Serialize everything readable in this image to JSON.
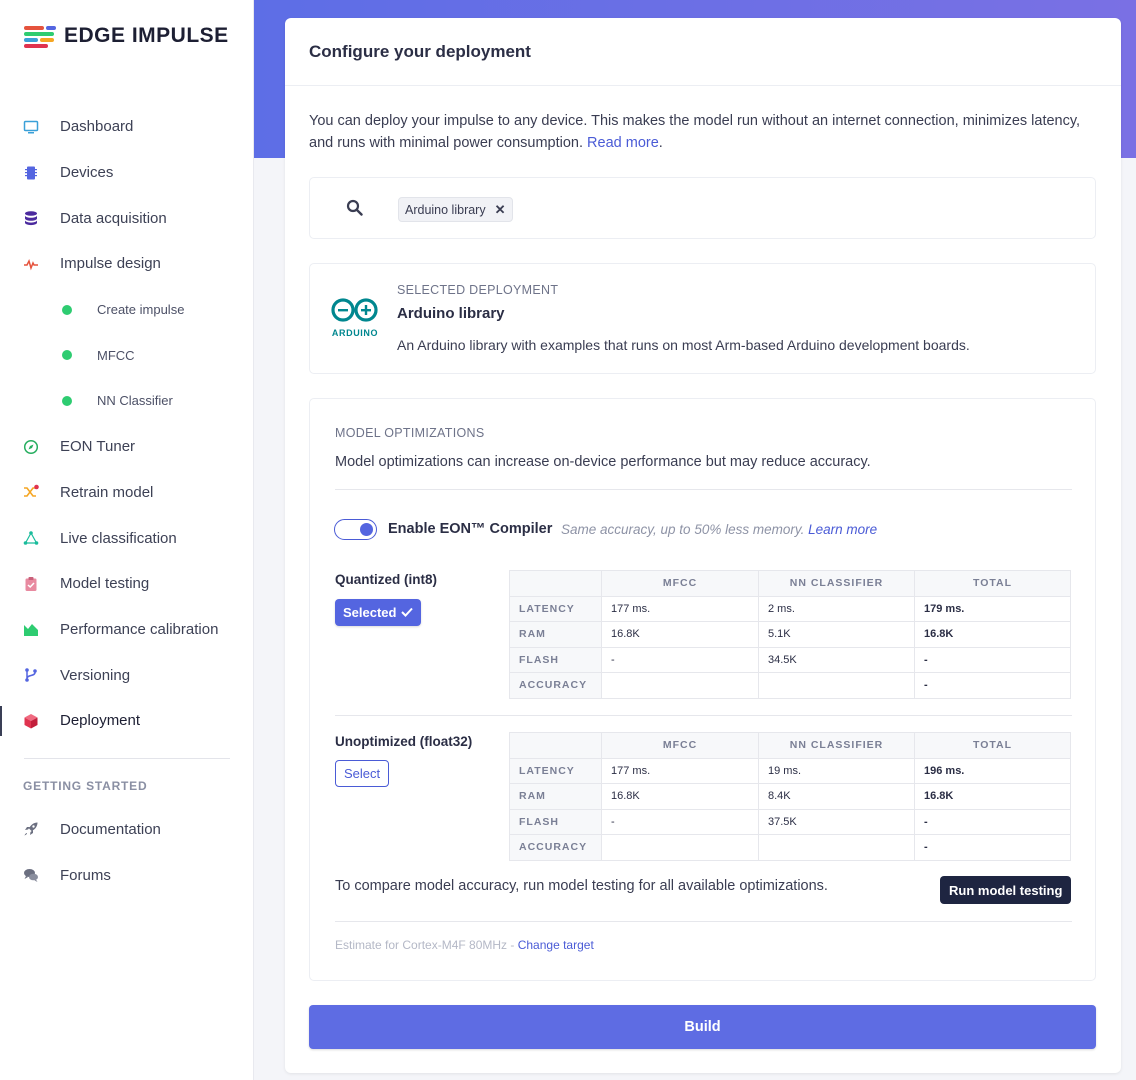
{
  "brand": {
    "name": "EDGE IMPULSE"
  },
  "sidebar": {
    "items": [
      {
        "label": "Dashboard",
        "icon": "monitor-icon",
        "color": "#3aa0d8"
      },
      {
        "label": "Devices",
        "icon": "chip-icon",
        "color": "#5465e0"
      },
      {
        "label": "Data acquisition",
        "icon": "database-icon",
        "color": "#4b2a9e"
      },
      {
        "label": "Impulse design",
        "icon": "pulse-icon",
        "color": "#e5533d"
      },
      {
        "label": "Create impulse",
        "sub": true
      },
      {
        "label": "MFCC",
        "sub": true
      },
      {
        "label": "NN Classifier",
        "sub": true
      },
      {
        "label": "EON Tuner",
        "icon": "compass-icon",
        "color": "#27ae60"
      },
      {
        "label": "Retrain model",
        "icon": "shuffle-icon",
        "color": "#f5a623"
      },
      {
        "label": "Live classification",
        "icon": "network-icon",
        "color": "#1abc9c"
      },
      {
        "label": "Model testing",
        "icon": "clipboard-check-icon",
        "color": "#e88aa0"
      },
      {
        "label": "Performance calibration",
        "icon": "area-chart-icon",
        "color": "#2ecc71"
      },
      {
        "label": "Versioning",
        "icon": "branch-icon",
        "color": "#5465e0"
      },
      {
        "label": "Deployment",
        "icon": "cube-icon",
        "color": "#e0334f",
        "active": true
      }
    ],
    "getting_started_heading": "GETTING STARTED",
    "footer_items": [
      {
        "label": "Documentation",
        "icon": "rocket-icon"
      },
      {
        "label": "Forums",
        "icon": "chat-icon"
      }
    ]
  },
  "main": {
    "title": "Configure your deployment",
    "intro_text": "You can deploy your impulse to any device. This makes the model run without an internet connection, minimizes latency, and runs with minimal power consumption.",
    "intro_link": "Read more",
    "search": {
      "chip_label": "Arduino library",
      "chip_remove": "✕"
    },
    "selected": {
      "label": "SELECTED DEPLOYMENT",
      "logo_text": "ARDUINO",
      "title": "Arduino library",
      "description": "An Arduino library with examples that runs on most Arm-based Arduino development boards."
    },
    "optimizations": {
      "label": "MODEL OPTIMIZATIONS",
      "description": "Model optimizations can increase on-device performance but may reduce accuracy.",
      "eon": {
        "enabled": true,
        "label": "Enable EON™ Compiler",
        "hint": "Same accuracy, up to 50% less memory.",
        "hint_link": "Learn more"
      },
      "columns": [
        "",
        "MFCC",
        "NN CLASSIFIER",
        "TOTAL"
      ],
      "variants": [
        {
          "title": "Quantized (int8)",
          "button": "Selected",
          "selected": true,
          "rows": [
            {
              "label": "LATENCY",
              "mfcc": "177 ms.",
              "nn": "2 ms.",
              "total": "179 ms."
            },
            {
              "label": "RAM",
              "mfcc": "16.8K",
              "nn": "5.1K",
              "total": "16.8K"
            },
            {
              "label": "FLASH",
              "mfcc": "-",
              "nn": "34.5K",
              "total": "-"
            },
            {
              "label": "ACCURACY",
              "mfcc": "",
              "nn": "",
              "total": "-"
            }
          ]
        },
        {
          "title": "Unoptimized (float32)",
          "button": "Select",
          "selected": false,
          "rows": [
            {
              "label": "LATENCY",
              "mfcc": "177 ms.",
              "nn": "19 ms.",
              "total": "196 ms."
            },
            {
              "label": "RAM",
              "mfcc": "16.8K",
              "nn": "8.4K",
              "total": "16.8K"
            },
            {
              "label": "FLASH",
              "mfcc": "-",
              "nn": "37.5K",
              "total": "-"
            },
            {
              "label": "ACCURACY",
              "mfcc": "",
              "nn": "",
              "total": "-"
            }
          ]
        }
      ],
      "compare_text": "To compare model accuracy, run model testing for all available optimizations.",
      "run_testing_button": "Run model testing",
      "estimate_text": "Estimate for Cortex-M4F 80MHz -",
      "change_target_link": "Change target"
    },
    "build_button": "Build"
  },
  "colors": {
    "accent": "#5465e0",
    "dark_button": "#1e2541",
    "success": "#2ecc71"
  }
}
